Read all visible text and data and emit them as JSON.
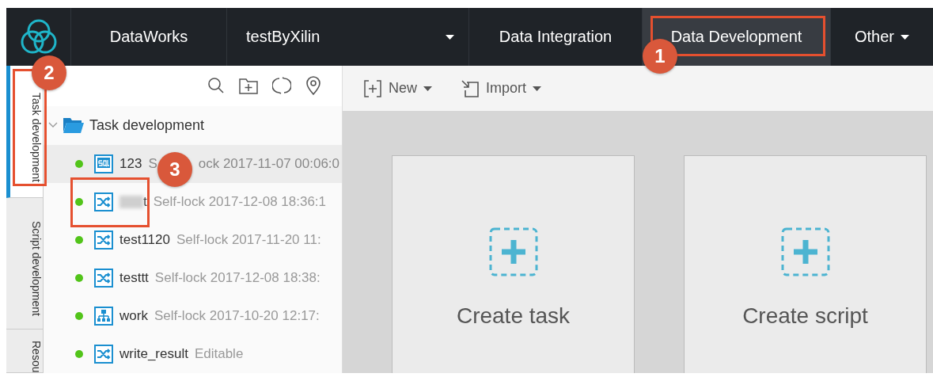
{
  "header": {
    "product": "DataWorks",
    "project": "testByXilin",
    "nav": [
      {
        "label": "Data Integration",
        "selected": false,
        "dropdown": false
      },
      {
        "label": "Data Development",
        "selected": true,
        "dropdown": false
      },
      {
        "label": "Other",
        "selected": false,
        "dropdown": true
      }
    ]
  },
  "side_tabs": [
    {
      "label": "Task development",
      "selected": true
    },
    {
      "label": "Script development",
      "selected": false
    },
    {
      "label": "Resou",
      "selected": false
    }
  ],
  "tree": {
    "root": {
      "label": "Task development",
      "expanded": true,
      "children": [
        {
          "kind": "sql",
          "name": "123",
          "note": "ock 2017-11-07 00:06:0",
          "prefix": "S",
          "color": "#52c41a",
          "selected": true,
          "redacted": false
        },
        {
          "kind": "shuffle",
          "name": "t",
          "note": "Self-lock 2017-12-08 18:36:1",
          "color": "#52c41a",
          "selected": false,
          "redacted": true
        },
        {
          "kind": "shuffle",
          "name": "test1120",
          "note": "Self-lock 2017-11-20 11:",
          "color": "#52c41a",
          "selected": false,
          "redacted": false
        },
        {
          "kind": "shuffle",
          "name": "testtt",
          "note": "Self-lock 2017-12-08 18:38:",
          "color": "#52c41a",
          "selected": false,
          "redacted": false
        },
        {
          "kind": "flow",
          "name": "work",
          "note": "Self-lock 2017-10-20 12:17:",
          "color": "#52c41a",
          "selected": false,
          "redacted": false
        },
        {
          "kind": "shuffle",
          "name": "write_result",
          "note": "Editable",
          "color": "#52c41a",
          "selected": false,
          "redacted": false
        }
      ]
    }
  },
  "toolbar": [
    {
      "kind": "new",
      "label": "New"
    },
    {
      "kind": "import",
      "label": "Import"
    }
  ],
  "cards": [
    {
      "label": "Create task"
    },
    {
      "label": "Create script"
    }
  ],
  "annotations": [
    {
      "label": "1"
    },
    {
      "label": "2"
    },
    {
      "label": "3"
    }
  ]
}
